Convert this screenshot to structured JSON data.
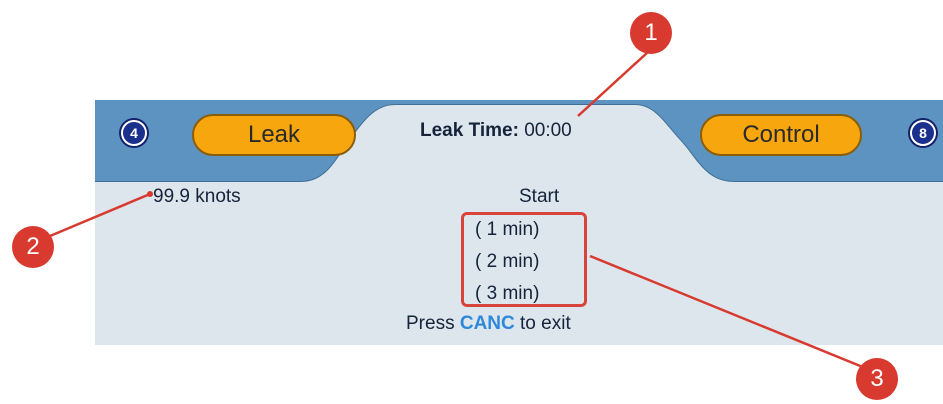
{
  "header": {
    "left_badge": "4",
    "left_button": "Leak",
    "leak_time_label": "Leak Time:",
    "leak_time_value": "00:00",
    "right_button": "Control",
    "right_badge": "8"
  },
  "main": {
    "speed": "99.9 knots",
    "start_label": "Start",
    "options": [
      "( 1 min)",
      "( 2 min)",
      "( 3 min)"
    ],
    "exit_prefix": "Press",
    "exit_key": "CANC",
    "exit_suffix": "to exit"
  },
  "callouts": [
    "1",
    "2",
    "3"
  ],
  "colors": {
    "header_blue": "#5d93c0",
    "button_orange": "#f7a60e",
    "callout_red": "#d83a30",
    "key_blue": "#2f88d8"
  }
}
